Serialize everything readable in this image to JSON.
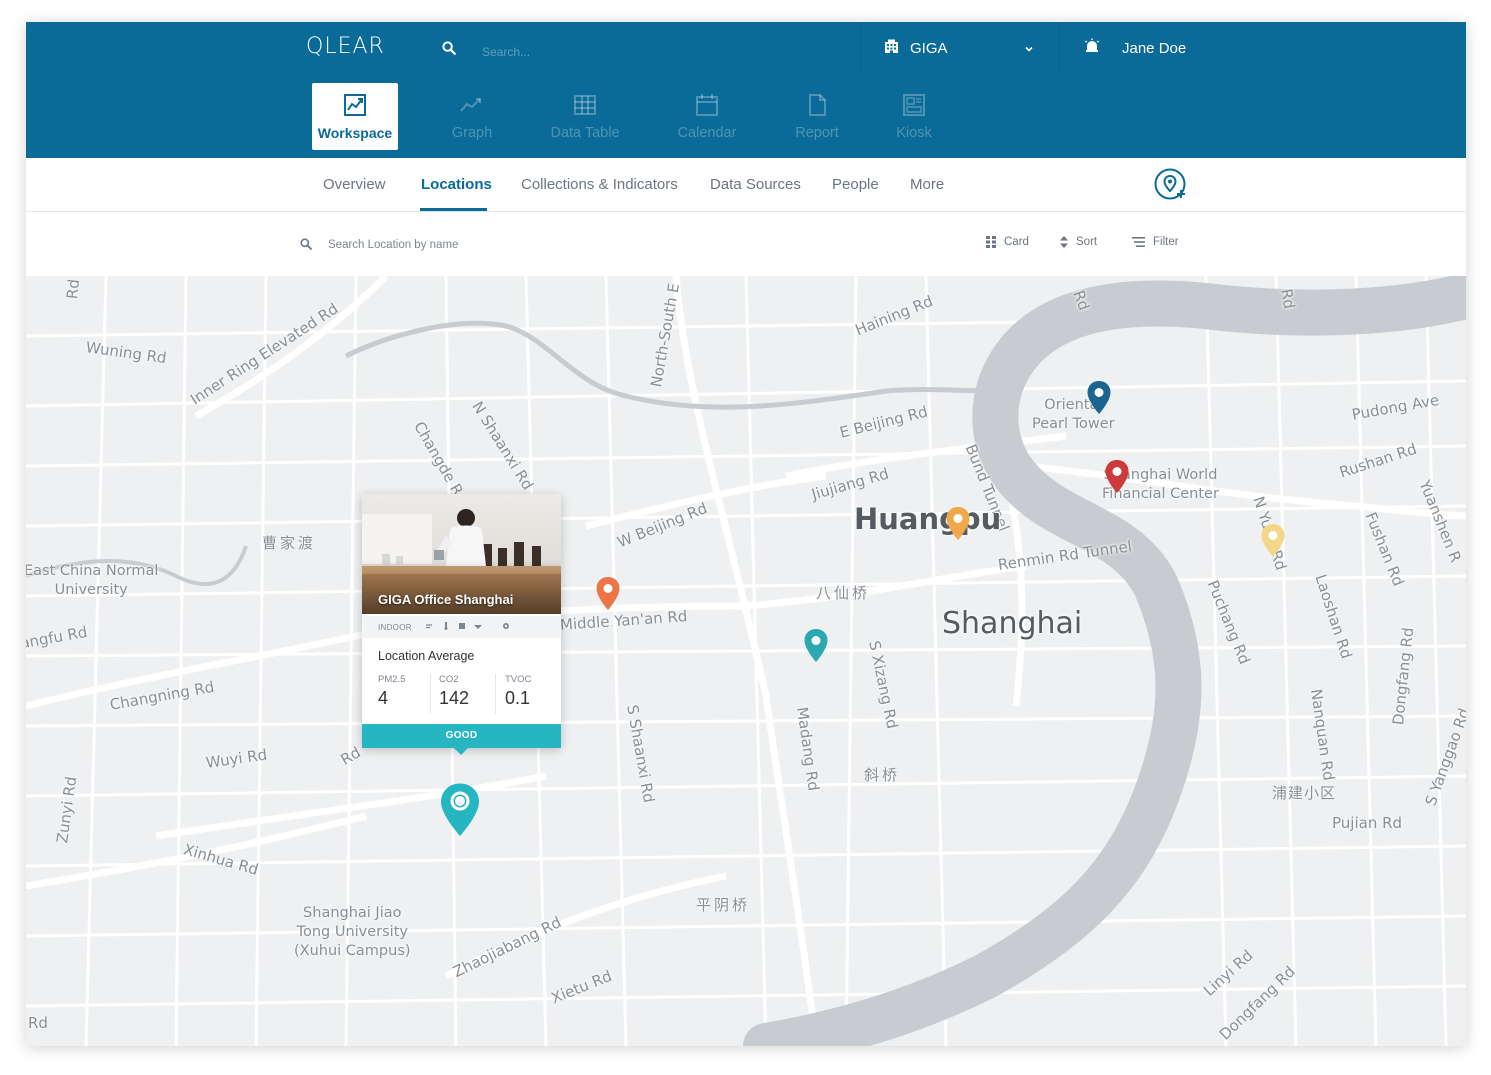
{
  "app": {
    "logo": "QLEAR"
  },
  "header": {
    "search_placeholder": "Search...",
    "org_name": "GIGA",
    "user_name": "Jane Doe"
  },
  "modules": [
    {
      "label": "Workspace",
      "icon": "workspace-icon",
      "active": true
    },
    {
      "label": "Graph",
      "icon": "graph-icon"
    },
    {
      "label": "Data Table",
      "icon": "table-icon"
    },
    {
      "label": "Calendar",
      "icon": "calendar-icon"
    },
    {
      "label": "Report",
      "icon": "report-icon"
    },
    {
      "label": "Kiosk",
      "icon": "kiosk-icon"
    }
  ],
  "tabs": [
    {
      "label": "Overview"
    },
    {
      "label": "Locations",
      "active": true
    },
    {
      "label": "Collections & Indicators"
    },
    {
      "label": "Data Sources"
    },
    {
      "label": "People"
    },
    {
      "label": "More"
    }
  ],
  "toolbar": {
    "search_placeholder": "Search Location by name",
    "card_label": "Card",
    "sort_label": "Sort",
    "filter_label": "Filter"
  },
  "map": {
    "district": "Huangpu",
    "city": "Shanghai",
    "labels": [
      "Wuning Rd",
      "Inner Ring Elevated Rd",
      "N Shaanxi Rd",
      "Changde R",
      "North-South E",
      "Haining Rd",
      "E Beijing Rd",
      "W Beijing Rd",
      "Jiujiang Rd",
      "Bund Tunnel",
      "Renmin Rd Tunnel",
      "Pudong Ave",
      "Rushan Rd",
      "Fushan Rd",
      "Yuanshen R",
      "Puchang Rd",
      "N Yuan Rd",
      "Laoshan Rd",
      "Nanquan Rd",
      "Dongfang Rd",
      "S Yanggao Rd",
      "Pujian Rd",
      "Linyi Rd",
      "Dongfang Rd",
      "Madang Rd",
      "S Xizang Rd",
      "S Shaanxi Rd",
      "Middle Yan'an Rd",
      "Changning Rd",
      "Wuyi Rd",
      "Zunyi Rd",
      "Xinhua Rd",
      "Zhaojiabang Rd",
      "Xietu Rd",
      "Jiangfu Rd",
      "Rd",
      "Rd",
      "Rd",
      "Rd",
      "Rd",
      "曹家渡",
      "八仙桥",
      "斜桥",
      "平阴桥",
      "浦建小区",
      "Oriental\nPearl Tower",
      "Shanghai World\nFinancial Center",
      "East China Normal\nUniversity",
      "Shanghai Jiao\nTong University\n(Xuhui Campus)"
    ]
  },
  "pins": [
    {
      "name": "dark-blue",
      "color": "#1b6690"
    },
    {
      "name": "red",
      "color": "#cc3a3a"
    },
    {
      "name": "orange-huangpu",
      "color": "#f0a94a"
    },
    {
      "name": "light-yellow",
      "color": "#f2d68a"
    },
    {
      "name": "orange-red",
      "color": "#ee7547"
    },
    {
      "name": "teal",
      "color": "#2aa9b2"
    },
    {
      "name": "teal-selected",
      "color": "#26b6c2"
    }
  ],
  "location_card": {
    "title": "GIGA Office Shanghai",
    "environment": "INDOOR",
    "section_title": "Location Average",
    "metrics": [
      {
        "label": "PM2.5",
        "value": "4"
      },
      {
        "label": "CO2",
        "value": "142"
      },
      {
        "label": "TVOC",
        "value": "0.1"
      }
    ],
    "status": "GOOD",
    "status_color": "#26b6c2"
  },
  "colors": {
    "brand": "#0a6a98",
    "map_bg": "#eef0f1",
    "river": "#c8ccd0"
  }
}
